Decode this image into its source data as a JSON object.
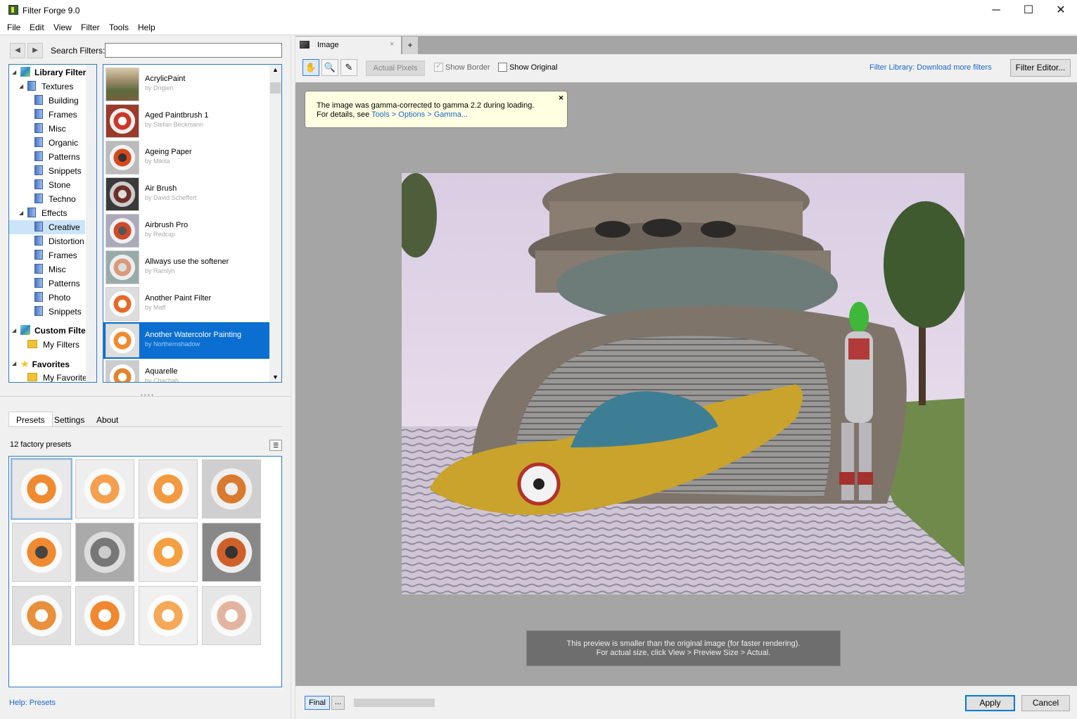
{
  "app": {
    "title": "Filter Forge 9.0"
  },
  "window_controls": {
    "minimize": "─",
    "maximize": "☐",
    "close": "✕"
  },
  "menu": [
    "File",
    "Edit",
    "View",
    "Filter",
    "Tools",
    "Help"
  ],
  "search": {
    "label": "Search Filters:",
    "value": ""
  },
  "tree": [
    {
      "label": "Library Filters",
      "kind": "root",
      "icon": "cube-icon",
      "expanded": true
    },
    {
      "label": "Textures",
      "kind": "group",
      "icon": "book-icon",
      "expanded": true
    },
    {
      "label": "Building",
      "kind": "leaf",
      "icon": "book-icon"
    },
    {
      "label": "Frames",
      "kind": "leaf",
      "icon": "book-icon"
    },
    {
      "label": "Misc",
      "kind": "leaf",
      "icon": "book-icon"
    },
    {
      "label": "Organic",
      "kind": "leaf",
      "icon": "book-icon"
    },
    {
      "label": "Patterns",
      "kind": "leaf",
      "icon": "book-icon"
    },
    {
      "label": "Snippets",
      "kind": "leaf",
      "icon": "book-icon"
    },
    {
      "label": "Stone",
      "kind": "leaf",
      "icon": "book-icon"
    },
    {
      "label": "Techno",
      "kind": "leaf",
      "icon": "book-icon"
    },
    {
      "label": "Effects",
      "kind": "group",
      "icon": "book-icon",
      "expanded": true
    },
    {
      "label": "Creative",
      "kind": "leaf",
      "icon": "book-icon",
      "selected": true
    },
    {
      "label": "Distortion",
      "kind": "leaf",
      "icon": "book-icon"
    },
    {
      "label": "Frames",
      "kind": "leaf",
      "icon": "book-icon"
    },
    {
      "label": "Misc",
      "kind": "leaf",
      "icon": "book-icon"
    },
    {
      "label": "Patterns",
      "kind": "leaf",
      "icon": "book-icon"
    },
    {
      "label": "Photo",
      "kind": "leaf",
      "icon": "book-icon"
    },
    {
      "label": "Snippets",
      "kind": "leaf",
      "icon": "book-icon"
    },
    {
      "label": "Custom Filters",
      "kind": "root",
      "icon": "cube-icon",
      "expanded": true
    },
    {
      "label": "My Filters",
      "kind": "group",
      "icon": "folder-icon"
    },
    {
      "label": "Favorites",
      "kind": "root",
      "icon": "star-icon",
      "expanded": true
    },
    {
      "label": "My Favorites",
      "kind": "group",
      "icon": "folder-icon"
    }
  ],
  "filters": [
    {
      "name": "AcrylicPaint",
      "author": "by Drigien"
    },
    {
      "name": "Aged Paintbrush 1",
      "author": "by Stefan Beckmann"
    },
    {
      "name": "Ageing Paper",
      "author": "by Mikita"
    },
    {
      "name": "Air Brush",
      "author": "by David Scheffert"
    },
    {
      "name": "Airbrush Pro",
      "author": "by Redcap"
    },
    {
      "name": "Allways use the softener",
      "author": "by Ramlyn"
    },
    {
      "name": "Another Paint Filter",
      "author": "by Maff"
    },
    {
      "name": "Another Watercolor Painting",
      "author": "by Northernshadow",
      "selected": true
    },
    {
      "name": "Aquarelle",
      "author": "by Chachah"
    }
  ],
  "bottom_tabs": [
    "Presets",
    "Settings",
    "About"
  ],
  "presets": {
    "count_label": "12 factory presets",
    "count": 12
  },
  "help": {
    "label": "Help: Presets"
  },
  "document": {
    "tab_title": "Image",
    "close": "×",
    "add": "+"
  },
  "toolbar": {
    "actual_pixels": "Actual Pixels",
    "show_border": "Show Border",
    "show_original": "Show Original",
    "library_link": "Filter Library: Download more filters",
    "editor_button": "Filter Editor..."
  },
  "gamma_note": {
    "line1": "The image was gamma-corrected to gamma 2.2 during loading.",
    "line2_prefix": "For details, see ",
    "line2_link": "Tools > Options > Gamma...",
    "close": "×"
  },
  "preview_note": {
    "line1": "This preview is smaller than the original image (for faster rendering).",
    "line2": "For actual size, click View > Preview Size > Actual."
  },
  "bottom": {
    "final": "Final",
    "dots": "...",
    "apply": "Apply",
    "cancel": "Cancel"
  },
  "colors": {
    "accent": "#0a6fd1",
    "link": "#1a66c8",
    "preview_bg": "#a5a5a5",
    "note_bg": "#ffffe1"
  }
}
